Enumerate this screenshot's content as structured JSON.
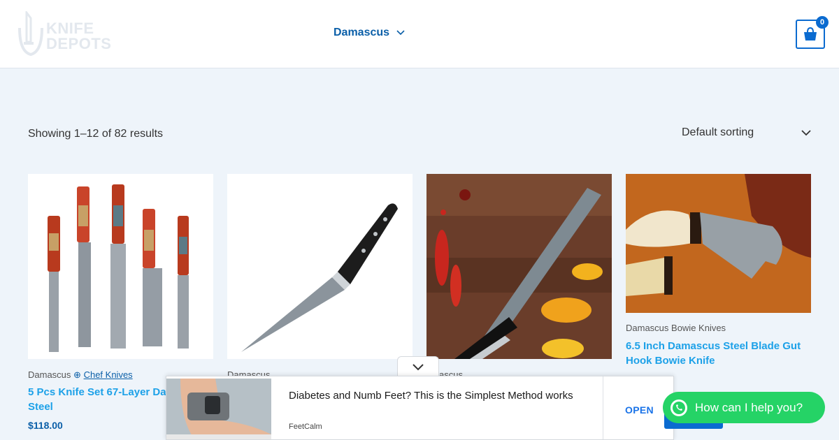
{
  "header": {
    "logo": {
      "line1": "KNIFE",
      "line2": "DEPOTS"
    },
    "nav_item": "Damascus",
    "cart_count": "0"
  },
  "shop": {
    "results_text": "Showing 1–12 of 82 results",
    "sorting": "Default sorting"
  },
  "products": [
    {
      "category": "Damascus",
      "subcategory": "Chef Knives",
      "title": "5 Pcs Knife Set 67-Layer Da",
      "title_line2": "Steel",
      "price": "$118.00"
    },
    {
      "category": "Damascus"
    },
    {
      "category": "amascus"
    },
    {
      "category": "Damascus Bowie Knives",
      "title": "6.5 Inch Damascus Steel Blade Gut Hook Bowie Knife"
    }
  ],
  "ad": {
    "title": "Diabetes and Numb Feet? This is the Simplest Method works",
    "brand": "FeetCalm",
    "cta": "OPEN"
  },
  "whatsapp": {
    "label": "How can I help you?"
  },
  "colors": {
    "accent": "#0b6bd0",
    "link": "#1da1e8",
    "whatsapp": "#25d366"
  }
}
